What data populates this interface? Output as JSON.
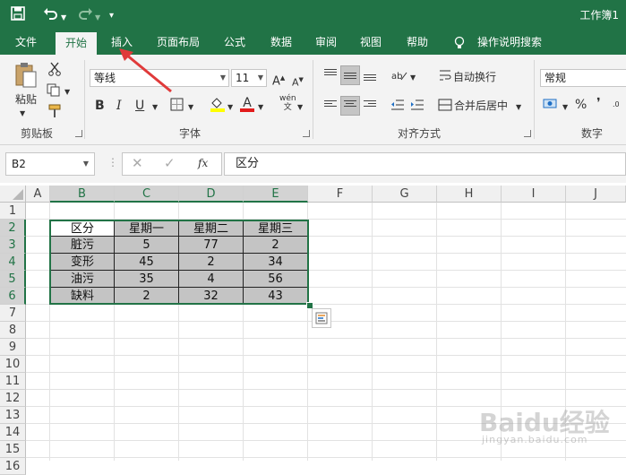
{
  "titlebar": {
    "save_icon": "save-icon",
    "undo_icon": "undo-icon",
    "redo_icon": "redo-icon",
    "customize_icon": "customize-qat-icon",
    "workbook_title": "工作簿1"
  },
  "tabs": [
    {
      "label": "文件"
    },
    {
      "label": "开始"
    },
    {
      "label": "插入"
    },
    {
      "label": "页面布局"
    },
    {
      "label": "公式"
    },
    {
      "label": "数据"
    },
    {
      "label": "审阅"
    },
    {
      "label": "视图"
    },
    {
      "label": "帮助"
    },
    {
      "label": "操作说明搜索"
    }
  ],
  "ribbon": {
    "clipboard": {
      "paste_label": "粘贴",
      "group_label": "剪贴板"
    },
    "font": {
      "font_name": "等线",
      "font_size": "11",
      "bold": "B",
      "italic": "I",
      "underline": "U",
      "font_color_letter": "A",
      "group_label": "字体",
      "phonetic_label": "wén"
    },
    "alignment": {
      "wrap_label": "自动换行",
      "merge_label": "合并后居中",
      "group_label": "对齐方式"
    },
    "number": {
      "format": "常规",
      "percent": "%",
      "group_label": "数字"
    }
  },
  "formula_bar": {
    "name_box": "B2",
    "fx": "fx",
    "value": "区分"
  },
  "columns": [
    "A",
    "B",
    "C",
    "D",
    "E",
    "F",
    "G",
    "H",
    "I",
    "J"
  ],
  "rows": [
    "1",
    "2",
    "3",
    "4",
    "5",
    "6",
    "7",
    "8",
    "9",
    "10",
    "11",
    "12",
    "13",
    "14",
    "15",
    "16"
  ],
  "table": {
    "header": [
      "区分",
      "星期一",
      "星期二",
      "星期三"
    ],
    "rows": [
      [
        "脏污",
        "5",
        "77",
        "2"
      ],
      [
        "变形",
        "45",
        "2",
        "34"
      ],
      [
        "油污",
        "35",
        "4",
        "56"
      ],
      [
        "缺料",
        "2",
        "32",
        "43"
      ]
    ]
  },
  "watermark": {
    "text": "Baidu经验",
    "subtext": "jingyan.baidu.com"
  },
  "colors": {
    "accent": "#217346",
    "arrow": "#e03a3a",
    "cell_shade": "#c4c4c4"
  }
}
